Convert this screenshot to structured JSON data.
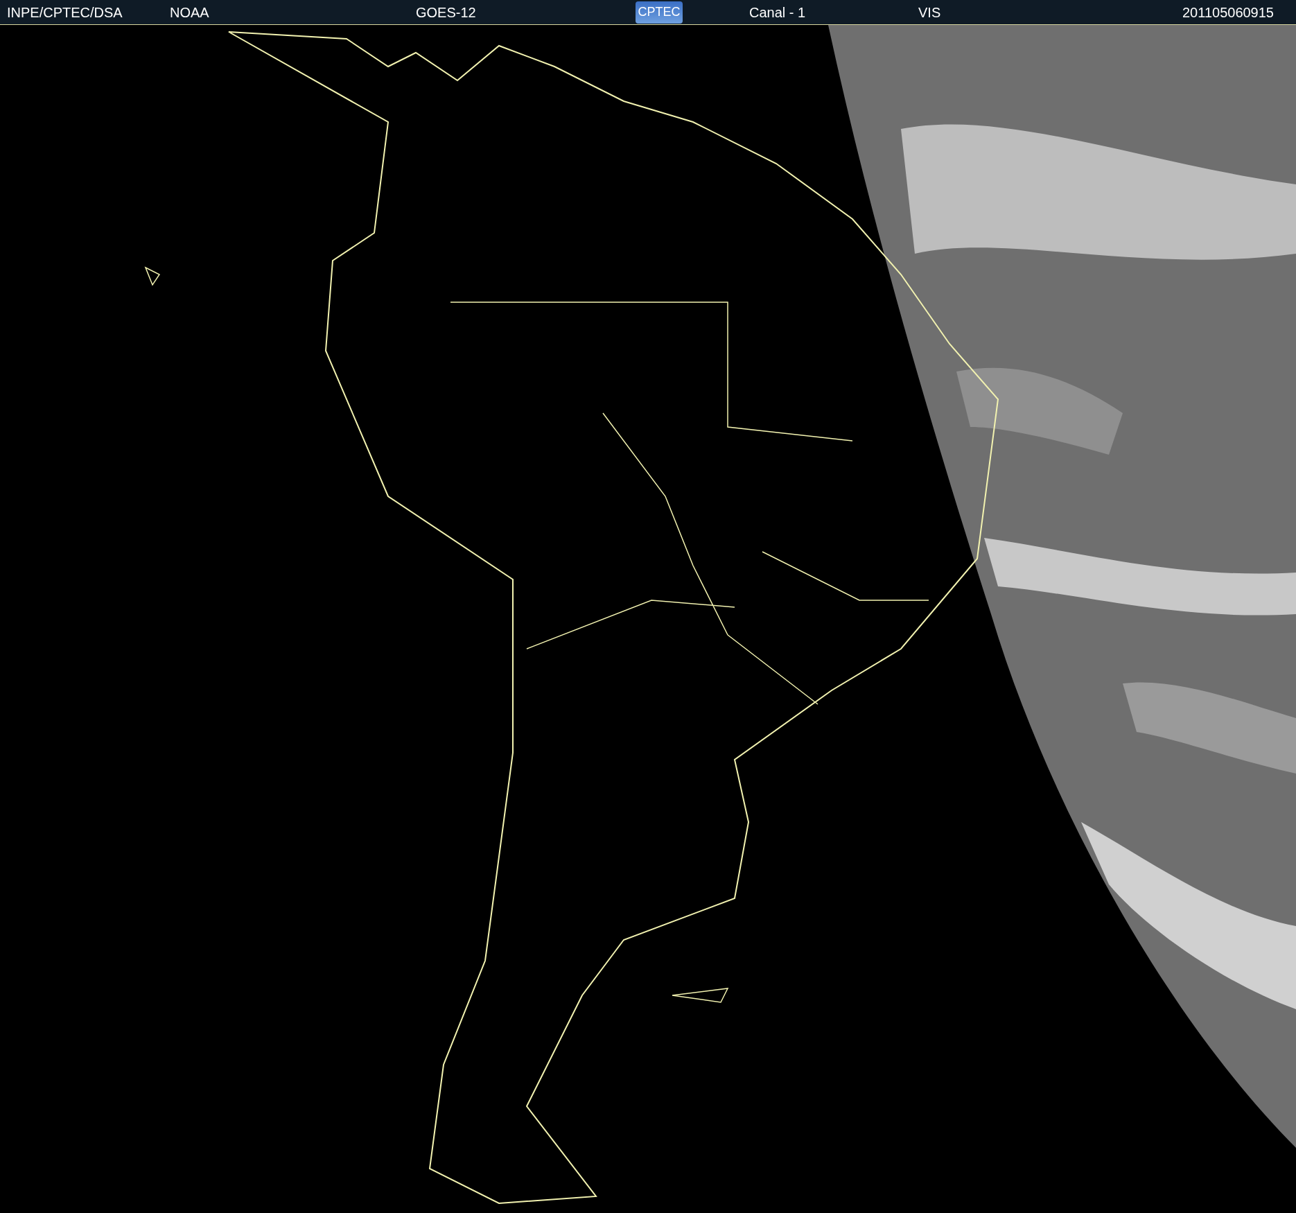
{
  "header": {
    "source": "INPE/CPTEC/DSA",
    "agency": "NOAA",
    "satellite": "GOES-12",
    "logo": "CPTEC",
    "channel": "Canal - 1",
    "band": "VIS",
    "timestamp": "201105060915"
  }
}
